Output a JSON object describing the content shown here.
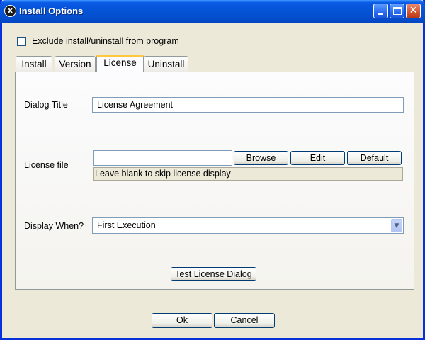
{
  "window": {
    "title": "Install Options",
    "icon": "app-x-icon",
    "accent": "#0553d6"
  },
  "exclude_checkbox": {
    "label": "Exclude install/uninstall from program",
    "checked": false
  },
  "tabs": [
    {
      "label": "Install",
      "active": false
    },
    {
      "label": "Version",
      "active": false
    },
    {
      "label": "License",
      "active": true
    },
    {
      "label": "Uninstall",
      "active": false
    }
  ],
  "license": {
    "dialog_title_label": "Dialog Title",
    "dialog_title_value": "License Agreement",
    "license_file_label": "License file",
    "license_file_value": "",
    "browse_label": "Browse",
    "edit_label": "Edit",
    "default_label": "Default",
    "hint": "Leave blank to skip license display",
    "display_when_label": "Display When?",
    "display_when_value": "First Execution",
    "test_button_label": "Test License Dialog"
  },
  "footer": {
    "ok_label": "Ok",
    "cancel_label": "Cancel"
  }
}
